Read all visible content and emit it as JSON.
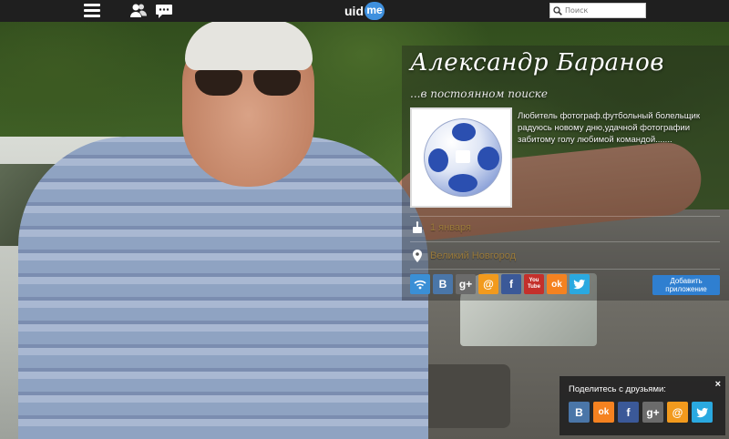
{
  "topbar": {
    "logo_text": "uid",
    "logo_badge": "me",
    "search_placeholder": "Поиск"
  },
  "profile": {
    "name": "Александр Баранов",
    "status": "...в постоянном поиске",
    "about": "Любитель фотограф.футбольный болельщик радуюсь новому дню,удачной фотографии забитому голу любимой командой.......",
    "birthday": "1 января",
    "location": "Великий Новгород",
    "add_app_label": "Добавить приложение"
  },
  "social_links": [
    {
      "icon": "rss-icon",
      "label": "",
      "color": "#3a8fd6"
    },
    {
      "icon": "vk-icon",
      "label": "В",
      "color": "#4a76a8"
    },
    {
      "icon": "gplus-icon",
      "label": "g+",
      "color": "#6b6b6b"
    },
    {
      "icon": "mail-icon",
      "label": "@",
      "color": "#f29a1d"
    },
    {
      "icon": "facebook-icon",
      "label": "f",
      "color": "#3b5998"
    },
    {
      "icon": "youtube-icon",
      "label": "You Tube",
      "color": "#c4302b"
    },
    {
      "icon": "odnoklassniki-icon",
      "label": "ok",
      "color": "#f58220"
    },
    {
      "icon": "twitter-icon",
      "label": "t",
      "color": "#2aa9e0"
    }
  ],
  "share": {
    "title": "Поделитесь с друзьями:",
    "close": "×",
    "buttons": [
      {
        "icon": "vk-icon",
        "label": "В",
        "color": "#4a76a8"
      },
      {
        "icon": "odnoklassniki-icon",
        "label": "ok",
        "color": "#f58220"
      },
      {
        "icon": "facebook-icon",
        "label": "f",
        "color": "#3b5998"
      },
      {
        "icon": "gplus-icon",
        "label": "g+",
        "color": "#6b6b6b"
      },
      {
        "icon": "mail-icon",
        "label": "@",
        "color": "#f29a1d"
      },
      {
        "icon": "twitter-icon",
        "label": "t",
        "color": "#2aa9e0"
      }
    ]
  }
}
